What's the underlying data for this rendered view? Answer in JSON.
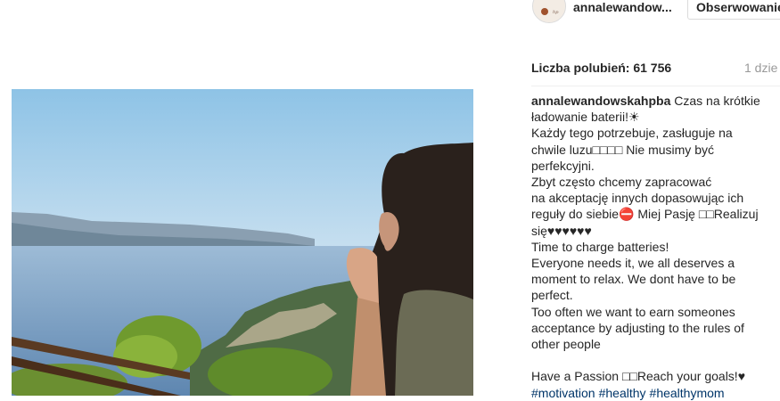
{
  "header": {
    "username": "annalewandow...",
    "follow_label": "Obserwowanie",
    "avatar_icon": "profile-avatar-icon"
  },
  "post": {
    "likes_label": "Liczba polubień: 61 756",
    "time_label": "1 dzie",
    "caption": {
      "author": "annalewandowskahpba",
      "first_line_rest": " Czas na krótkie",
      "lines": [
        "ładowanie baterii!☀",
        "Każdy tego potrzebuje, zasługuje na",
        "chwile luzu□□□□ Nie musimy być",
        "perfekcyjni.",
        "Zbyt często chcemy zapracować",
        "na akceptację innych dopasowując ich",
        "reguły do siebie⛔ Miej Pasję □□Realizuj",
        "się♥♥♥♥♥♥",
        "Time to charge batteries!",
        "Everyone needs it, we all deserves a",
        "moment to relax. We dont have to be",
        "perfect.",
        "Too often we want to earn someones",
        "acceptance by adjusting to the rules of",
        "other people",
        "",
        "Have a Passion □□Reach your goals!♥"
      ],
      "hashtags": [
        "#motivation",
        "#healthy",
        "#healthymom"
      ]
    }
  },
  "colors": {
    "text": "#262626",
    "muted": "#999999",
    "hashtag": "#003569",
    "border": "#dbdbdb"
  }
}
